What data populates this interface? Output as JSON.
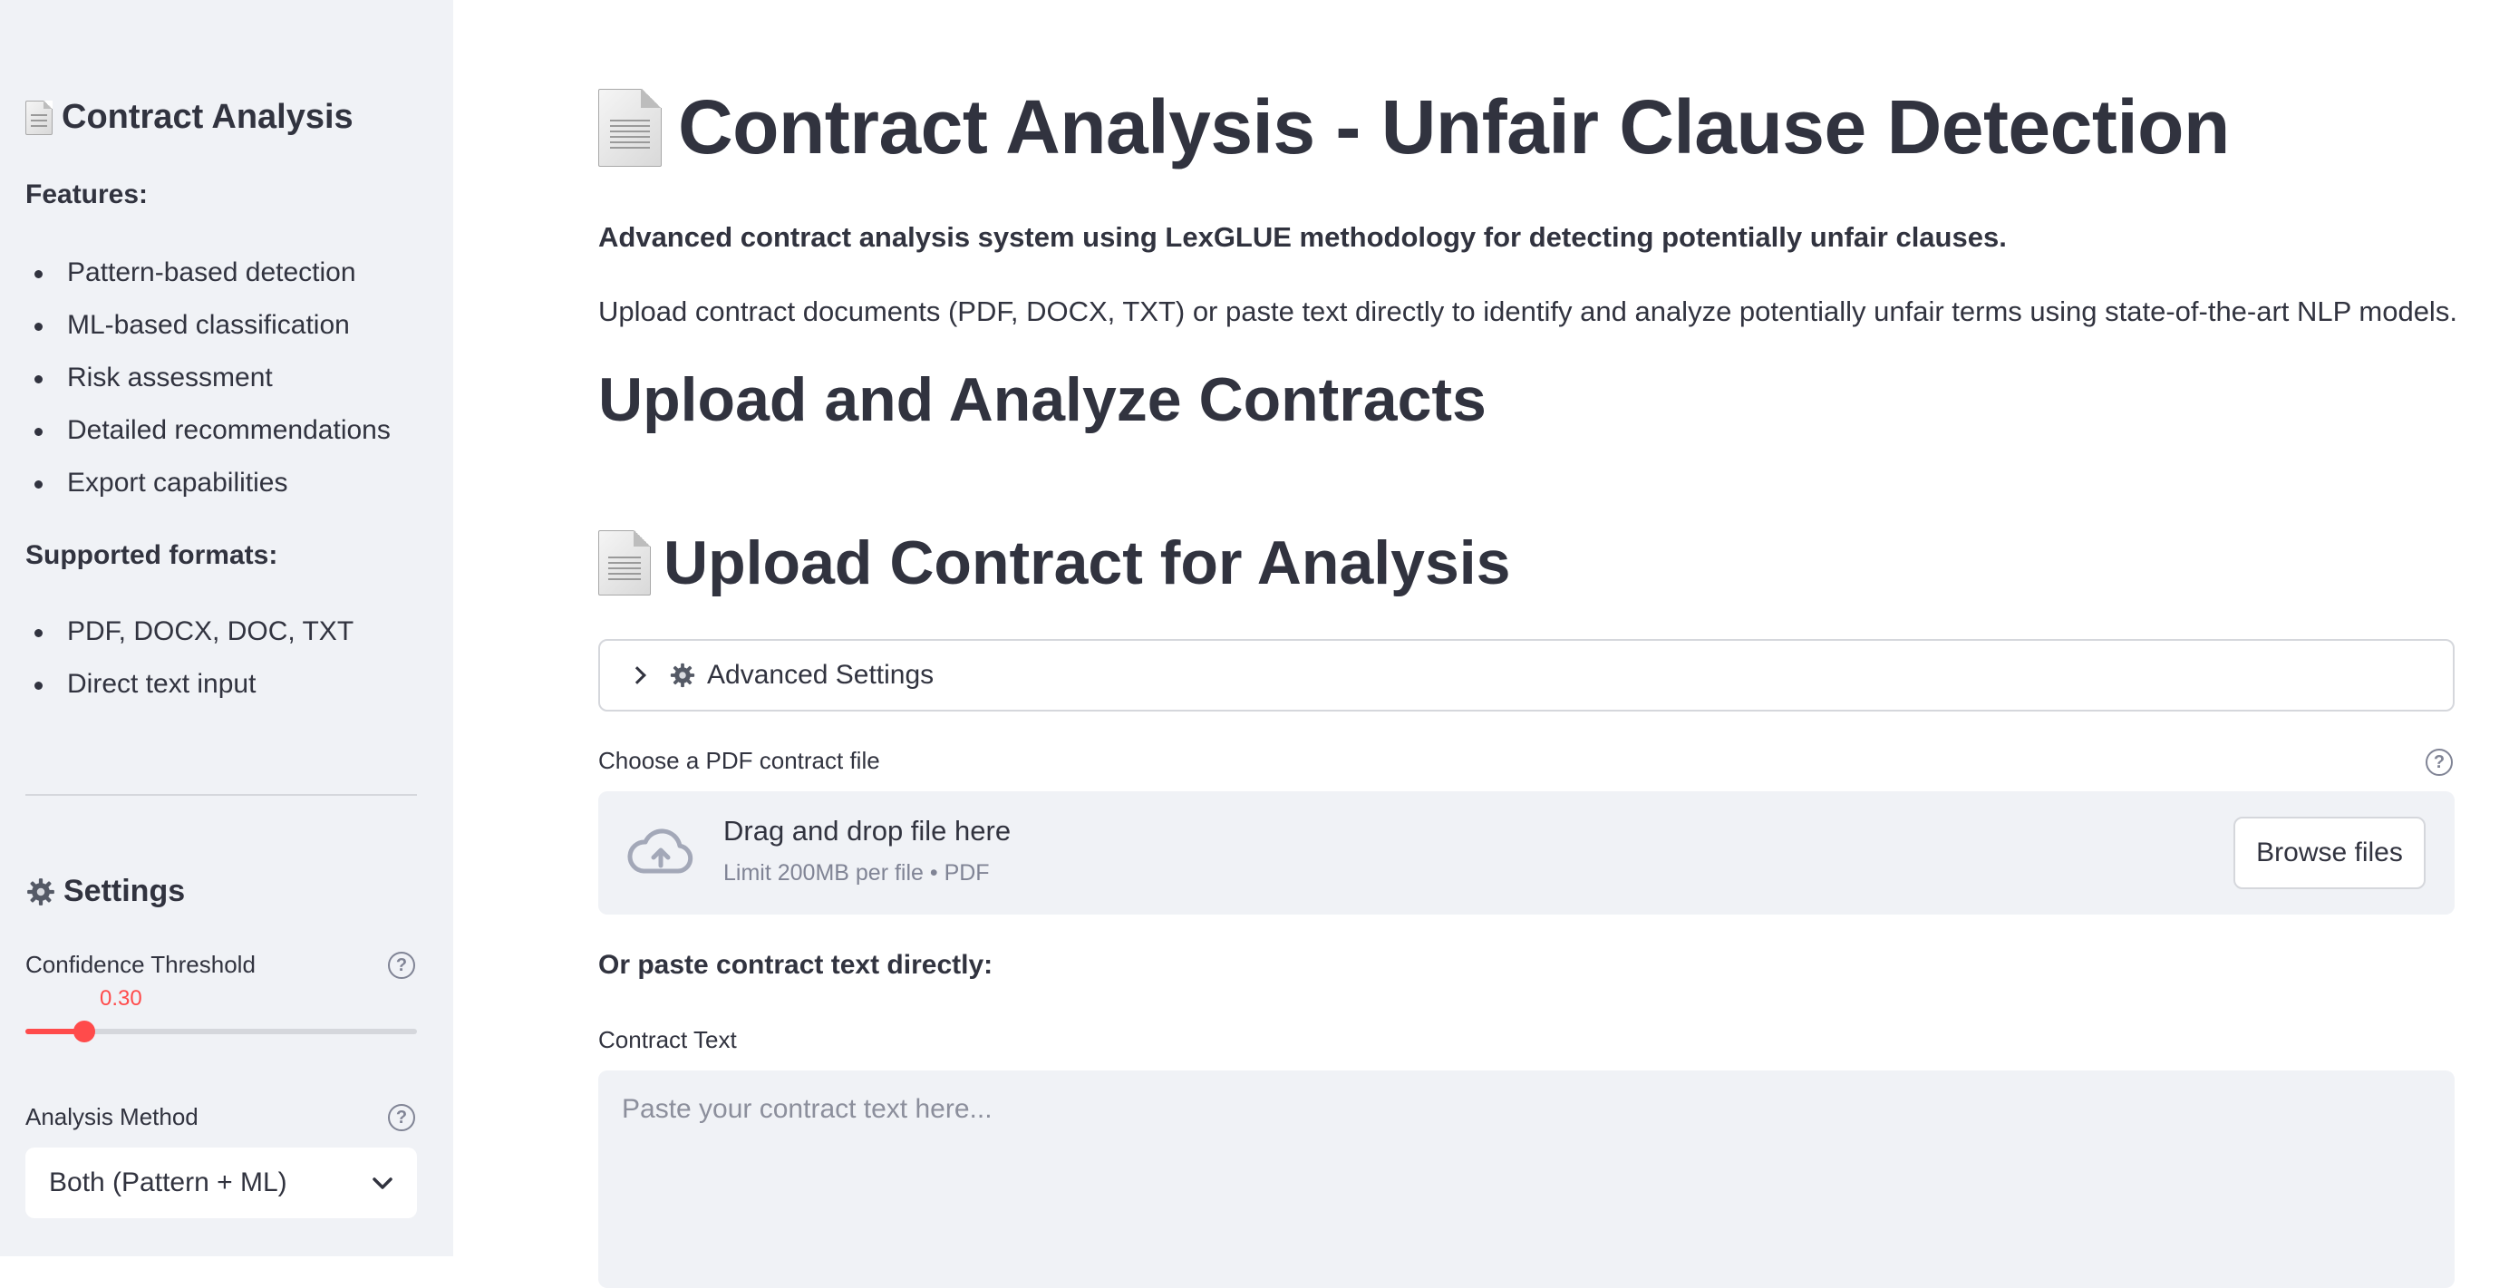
{
  "sidebar": {
    "title": "Contract Analysis",
    "features_heading": "Features:",
    "features": [
      "Pattern-based detection",
      "ML-based classification",
      "Risk assessment",
      "Detailed recommendations",
      "Export capabilities"
    ],
    "formats_heading": "Supported formats:",
    "formats": [
      "PDF, DOCX, DOC, TXT",
      "Direct text input"
    ],
    "settings_title": "Settings",
    "confidence": {
      "label": "Confidence Threshold",
      "value": 0.3,
      "value_text": "0.30",
      "min": 0,
      "max": 1
    },
    "analysis_method": {
      "label": "Analysis Method",
      "selected": "Both (Pattern + ML)"
    }
  },
  "main": {
    "title": "Contract Analysis - Unfair Clause Detection",
    "intro_bold": "Advanced contract analysis system using LexGLUE methodology for detecting potentially unfair clauses.",
    "intro_text": "Upload contract documents (PDF, DOCX, TXT) or paste text directly to identify and analyze potentially unfair terms using state-of-the-art NLP models.",
    "section_heading": "Upload and Analyze Contracts",
    "upload_heading": "Upload Contract for Analysis",
    "advanced_settings": "Advanced Settings",
    "uploader": {
      "label": "Choose a PDF contract file",
      "drag_text": "Drag and drop file here",
      "limit_text": "Limit 200MB per file • PDF",
      "browse_label": "Browse files"
    },
    "or_paste": "Or paste contract text directly:",
    "textarea": {
      "label": "Contract Text",
      "placeholder": "Paste your contract text here...",
      "value": ""
    }
  },
  "colors": {
    "accent": "#FF4B4B",
    "sidebar_bg": "#F0F2F6",
    "text": "#31333F",
    "muted": "#808495"
  }
}
